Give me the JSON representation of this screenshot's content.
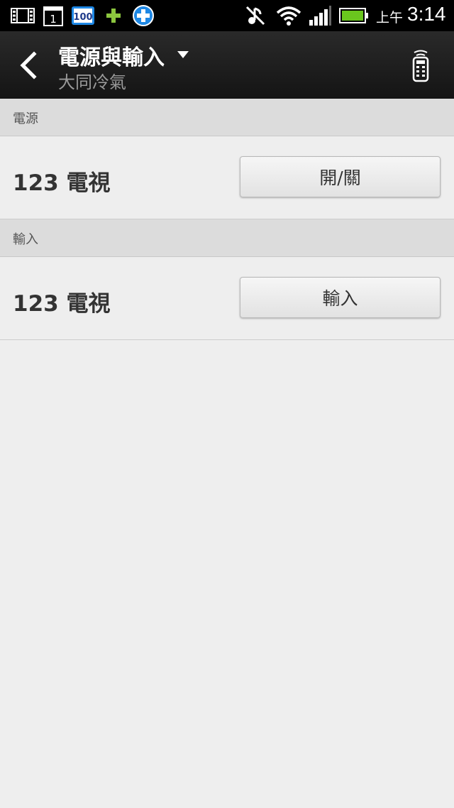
{
  "status_bar": {
    "icons": [
      "film-icon",
      "calendar-icon",
      "badge-100-icon",
      "plus-icon",
      "cross-icon",
      "mute-icon",
      "wifi-icon",
      "signal-icon",
      "battery-icon"
    ],
    "calendar_day": "1",
    "badge_text": "100",
    "ampm": "上午",
    "time": "3:14"
  },
  "action_bar": {
    "title": "電源與輸入",
    "subtitle": "大同冷氣",
    "icons": [
      "back-icon",
      "dropdown-arrow-icon",
      "remote-control-icon"
    ]
  },
  "sections": [
    {
      "header": "電源",
      "device": "123 電視",
      "button": "開/關"
    },
    {
      "header": "輸入",
      "device": "123 電視",
      "button": "輸入"
    }
  ],
  "colors": {
    "status_bar": "#000000",
    "action_bar": "#1e1e1e",
    "section_header": "#dcdcdc",
    "background": "#eeeeee",
    "battery": "#6ac61e",
    "plus": "#8cc63f",
    "badge": "#1e88e5"
  }
}
